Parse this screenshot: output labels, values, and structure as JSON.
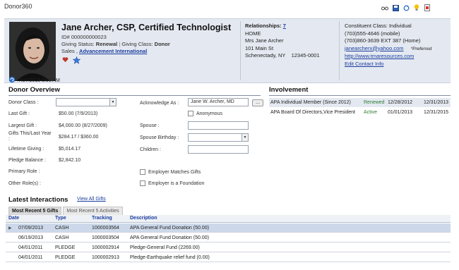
{
  "window": {
    "title": "Donor360"
  },
  "toolbar": {
    "icons": [
      "glasses-icon",
      "save-icon",
      "refresh-icon",
      "lightbulb-icon",
      "export-icon"
    ]
  },
  "donor": {
    "name": "Jane Archer, CSP, Certified Technologist",
    "id_line": "ID# 000000000023",
    "giving_status_label": "Giving Status:",
    "giving_status": "Renewal",
    "giving_class_label": "Giving Class:",
    "giving_class": "Donor",
    "sales_label": "Sales ,",
    "company": "Advancement International"
  },
  "relationships": {
    "label": "Relationships:",
    "count": "7",
    "address_type": "HOME",
    "line1": "Mrs Jane Archer",
    "line2": "101 Main St",
    "line3": "Schenectady, NY    12345-0001"
  },
  "constituent": {
    "class_line": "Constituent Class: Individual",
    "phone_mobile": "(703)555-4646 (mobile)",
    "phone_home": "(703)860-3639 EXT 387 (Home)",
    "email": "janearcherx@yahoo.com",
    "preferred": "*Preferred",
    "website": "http://www.tmaresources.com",
    "edit_link": "Edit Contact Info"
  },
  "timestamp": "7/27/2013 3:00 AM",
  "overview": {
    "title": "Donor Overview",
    "donor_class_label": "Donor Class :",
    "last_gift_label": "Last Gift :",
    "last_gift": "$50.00 (7/9/2013)",
    "largest_gift_label": "Largest Gift :",
    "largest_gift": "$4,000.00 (8/27/2009)",
    "gifts_label": "Gifts This/Last Year :",
    "gifts": "$284.17 / $360.00",
    "lifetime_label": "Lifetime Giving :",
    "lifetime": "$5,014.17",
    "pledge_label": "Pledge Balance :",
    "pledge": "$2,842.10",
    "primary_role_label": "Primary Role :",
    "other_roles_label": "Other Role(s) :",
    "acknowledge_label": "Acknowledge As :",
    "acknowledge_value": "Jane W. Archer, MD",
    "more_button": "...",
    "anonymous_label": "Anonymous",
    "spouse_label": "Spouse :",
    "spouse_birthday_label": "Spouse Birthday :",
    "children_label": "Children :",
    "employer_matches_label": "Employer Matches Gifts",
    "employer_foundation_label": "Employer is a Foundation"
  },
  "involvement": {
    "title": "Involvement",
    "rows": [
      {
        "name": "APA Individual Member (Since 2012)",
        "status": "Renewed",
        "start": "12/28/2012",
        "end": "12/31/2013"
      },
      {
        "name": "APA Board Of Directors,Vice President",
        "status": "Active",
        "start": "01/01/2013",
        "end": "12/31/2015"
      }
    ]
  },
  "interactions": {
    "title": "Latest Interactions",
    "view_all": "View All Gifts",
    "tabs": [
      "Most Recent 5 Gifts",
      "Most Recent 5 Activities"
    ],
    "columns": [
      "Date",
      "Type",
      "Tracking",
      "Description"
    ],
    "rows": [
      {
        "date": "07/09/2013",
        "type": "CASH",
        "tracking": "1000003564",
        "description": "APA General Fund Donation (50.00)"
      },
      {
        "date": "06/19/2013",
        "type": "CASH",
        "tracking": "1000003504",
        "description": "APA General Fund Donation (50.00)"
      },
      {
        "date": "04/01/2011",
        "type": "PLEDGE",
        "tracking": "1000002914",
        "description": "Pledge-General Fund (2269.00)"
      },
      {
        "date": "04/01/2011",
        "type": "PLEDGE",
        "tracking": "1000002913",
        "description": "Pledge-Earthquake relief fund (0.00)"
      }
    ]
  },
  "colors": {
    "accent_link": "#1a3d9e",
    "renewed": "#2e7d32",
    "active": "#2e7d32",
    "header_band": "#e4e9f1",
    "selected_row": "#cdd9ea"
  }
}
